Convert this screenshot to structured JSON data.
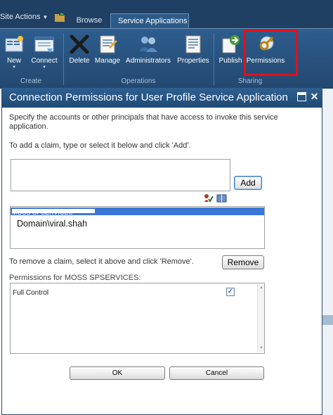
{
  "topbar": {
    "site_actions": "Site Actions",
    "tabs": [
      "Browse",
      "Service Applications"
    ]
  },
  "ribbon": {
    "buttons": {
      "new": {
        "label": "New",
        "sub": "▾"
      },
      "connect": {
        "label": "Connect",
        "sub": "▾"
      },
      "delete": {
        "label": "Delete"
      },
      "manage": {
        "label": "Manage"
      },
      "administrators": {
        "label": "Administrators"
      },
      "properties": {
        "label": "Properties"
      },
      "publish": {
        "label": "Publish"
      },
      "permissions": {
        "label": "Permissions"
      }
    },
    "groups": [
      "Create",
      "Operations",
      "Sharing"
    ],
    "highlight_color": "#e1101a"
  },
  "dialog": {
    "title": "Connection Permissions for User Profile Service Application",
    "instructions": "Specify the accounts or other principals that have access to invoke this service application.",
    "add_hint": "To add a claim, type or select it below and click 'Add'.",
    "add_button": "Add",
    "claims": {
      "selected": "MOSS SPSERVICES",
      "other": "Domain\\viral.shah"
    },
    "remove_hint": "To remove a claim, select it above and click 'Remove'.",
    "remove_button": "Remove",
    "permissions_label": "Permissions for MOSS SPSERVICES:",
    "permissions": [
      {
        "name": "Full Control",
        "checked": true
      }
    ],
    "ok_button": "OK",
    "cancel_button": "Cancel"
  },
  "colors": {
    "ribbon": "#2d5d8e",
    "title_bar": "#2f5f91",
    "selection": "#3b78d6"
  }
}
